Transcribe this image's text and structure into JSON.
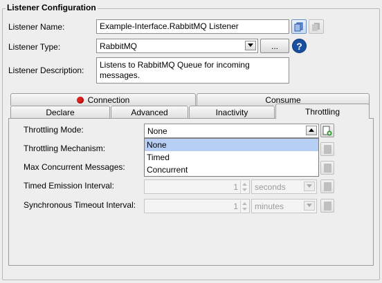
{
  "section_title": "Listener Configuration",
  "fields": {
    "name_label": "Listener Name:",
    "name_value": "Example-Interface.RabbitMQ Listener",
    "type_label": "Listener Type:",
    "type_value": "RabbitMQ",
    "type_browse_label": "...",
    "description_label": "Listener Description:",
    "description_value": "Listens to RabbitMQ Queue for incoming messages."
  },
  "tabs_row1": [
    {
      "label": "Connection",
      "status_color": "#e02020"
    },
    {
      "label": "Consume"
    }
  ],
  "tabs_row2": [
    {
      "label": "Declare"
    },
    {
      "label": "Advanced"
    },
    {
      "label": "Inactivity"
    },
    {
      "label": "Throttling",
      "active": true
    }
  ],
  "throttling": {
    "mode_label": "Throttling Mode:",
    "mode_value": "None",
    "mechanism_label": "Throttling Mechanism:",
    "max_concurrent_label": "Max Concurrent Messages:",
    "timed_emission_label": "Timed Emission Interval:",
    "timed_emission_value": "1",
    "timed_emission_unit": "seconds",
    "sync_timeout_label": "Synchronous Timeout Interval:",
    "sync_timeout_value": "1",
    "sync_timeout_unit": "minutes"
  },
  "mode_dropdown": {
    "options": [
      "None",
      "Timed",
      "Concurrent"
    ],
    "selected": "None"
  },
  "colors": {
    "help_icon": "#1a4fa0",
    "add_icon": "#2e9a2e",
    "selection": "#b8cff5"
  }
}
